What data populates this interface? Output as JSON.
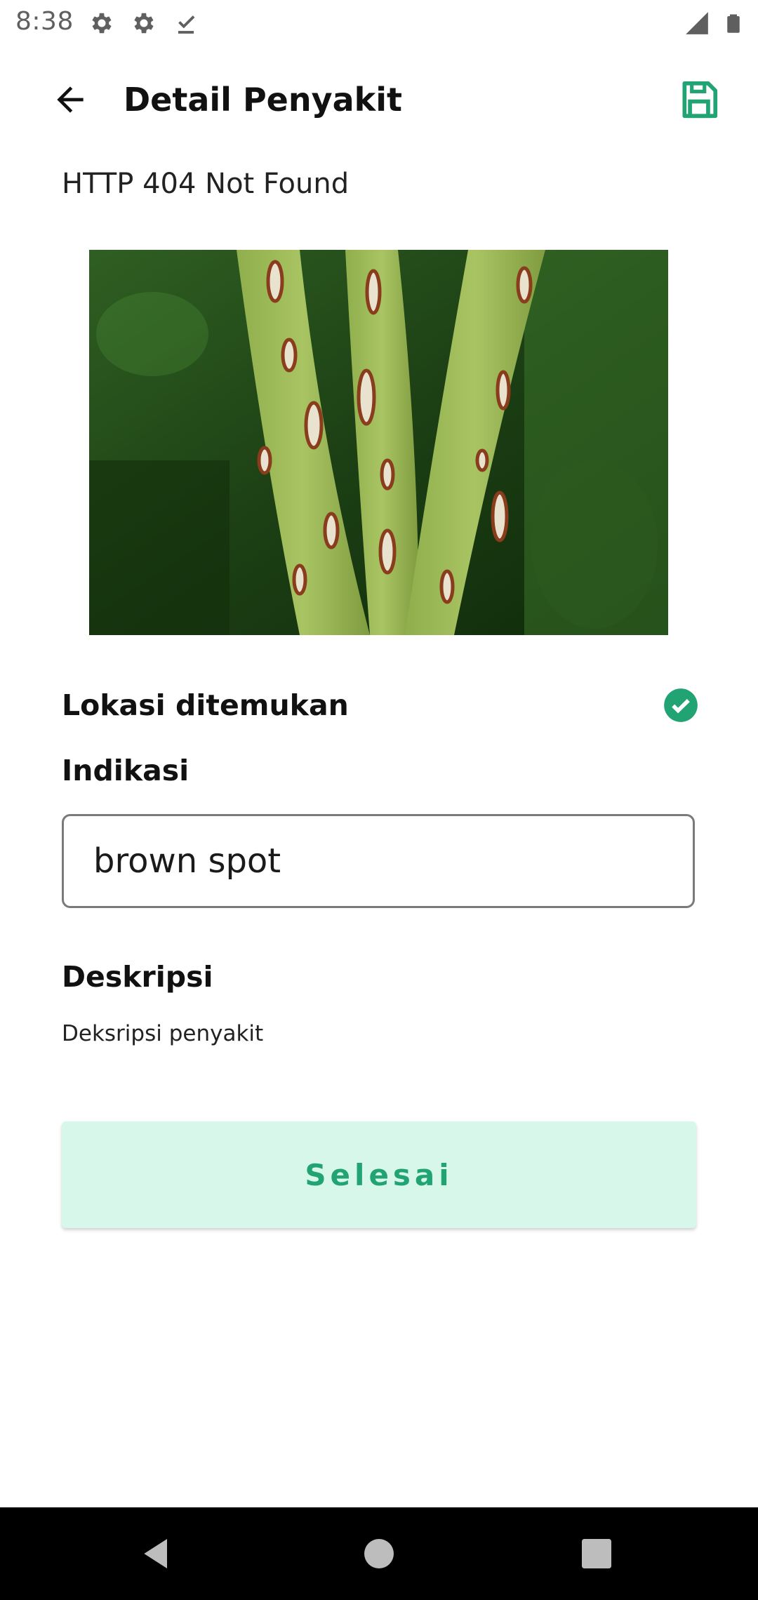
{
  "status_bar": {
    "time": "8:38",
    "left_icons": [
      "gear-icon",
      "gear-icon",
      "download-done-icon"
    ],
    "right_icons": [
      "signal-icon",
      "battery-icon"
    ]
  },
  "app_bar": {
    "title": "Detail Penyakit",
    "back_icon": "arrow-left-icon",
    "save_icon": "save-icon"
  },
  "error_message": "HTTP 404 Not Found",
  "image": {
    "subject": "rice leaves with brown spot lesions"
  },
  "lokasi": {
    "label": "Lokasi ditemukan",
    "status_icon": "check-circle-icon"
  },
  "indikasi": {
    "label": "Indikasi",
    "value": "brown spot"
  },
  "deskripsi": {
    "label": "Deskripsi",
    "text": "Deksripsi penyakit"
  },
  "actions": {
    "finish_label": "Selesai"
  },
  "colors": {
    "accent": "#21a374",
    "button_bg": "#d7f7ea",
    "check_green": "#21a374",
    "nav_bg": "#000000"
  },
  "nav_bar": {
    "buttons": [
      "back-triangle-icon",
      "home-circle-icon",
      "recents-square-icon"
    ]
  }
}
